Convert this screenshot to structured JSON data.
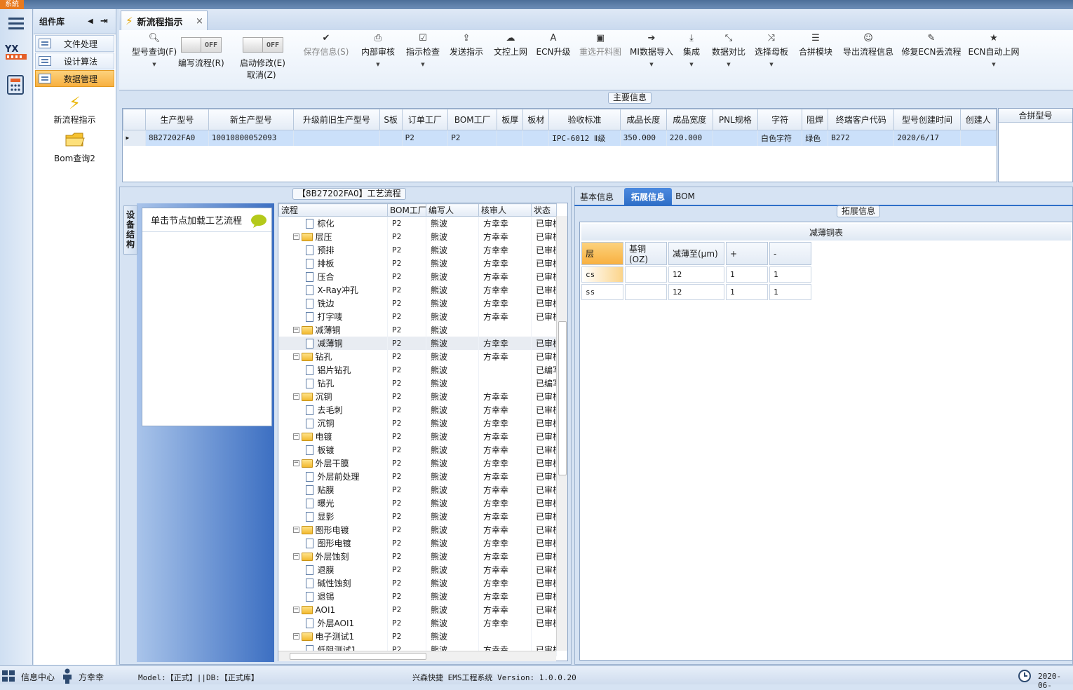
{
  "app": {
    "system_badge": "系統"
  },
  "left_rail": {
    "items": [
      {
        "icon": "menu-icon"
      },
      {
        "icon": "yx-logo-icon"
      },
      {
        "icon": "calculator-icon"
      }
    ]
  },
  "component_library": {
    "title": "组件库",
    "items": [
      {
        "label": "文件处理"
      },
      {
        "label": "设计算法"
      },
      {
        "label": "数据管理",
        "active": true
      }
    ],
    "shortcuts": [
      {
        "label": "新流程指示",
        "icon": "lightning-icon"
      },
      {
        "label": "Bom查询2",
        "icon": "folder-icon"
      }
    ]
  },
  "document_tab": {
    "label": "新流程指示",
    "close": "×"
  },
  "ribbon": {
    "buttons": [
      {
        "label": "型号查询(F)",
        "icon": "search-icon",
        "dropdown": true
      },
      {
        "label": "保存信息(S)",
        "icon": "check-icon",
        "disabled": true
      },
      {
        "label": "内部审核",
        "icon": "print-icon",
        "dropdown": true
      },
      {
        "label": "指示检查",
        "icon": "checkbox-icon",
        "dropdown": true
      },
      {
        "label": "发送指示",
        "icon": "upload-icon"
      },
      {
        "label": "文控上网",
        "icon": "cloud-upload-icon"
      },
      {
        "label": "ECN升级",
        "icon": "font-icon"
      },
      {
        "label": "重选开料图",
        "icon": "image-icon",
        "disabled": true
      },
      {
        "label": "MI数据导入",
        "icon": "sign-in-icon",
        "dropdown": true
      },
      {
        "label": "集成",
        "icon": "download-icon",
        "dropdown": true
      },
      {
        "label": "数据对比",
        "icon": "compress-icon",
        "dropdown": true
      },
      {
        "label": "选择母板",
        "icon": "shuffle-icon",
        "dropdown": true
      },
      {
        "label": "合拼模块",
        "icon": "list-icon"
      },
      {
        "label": "导出流程信息",
        "icon": "smile-icon"
      },
      {
        "label": "修复ECN丢流程",
        "icon": "wrench-icon"
      },
      {
        "label": "ECN自动上网",
        "icon": "star-icon",
        "dropdown": true
      }
    ],
    "toggles": [
      {
        "state": "OFF",
        "label": "编写流程(R)"
      },
      {
        "state": "OFF",
        "label": "启动修改(E)",
        "label2": "取消(Z)"
      }
    ]
  },
  "main_info": {
    "title": "主要信息",
    "columns": [
      "生产型号",
      "新生产型号",
      "升级前旧生产型号",
      "S板",
      "订单工厂",
      "BOM工厂",
      "板厚",
      "板材",
      "验收标准",
      "成品长度",
      "成品宽度",
      "PNL规格",
      "字符",
      "阻焊",
      "终端客户代码",
      "型号创建时间",
      "创建人"
    ],
    "rows": [
      [
        "8B27202FA0",
        "10010800052093",
        "",
        "",
        "P2",
        "P2",
        "",
        "",
        "IPC-6012 Ⅱ级",
        "350.000",
        "220.000",
        "",
        "白色字符",
        "绿色",
        "B272",
        "2020/6/17",
        ""
      ]
    ]
  },
  "merge_panel": {
    "title": "合拼型号"
  },
  "process_panel": {
    "title": "【8B27202FA0】工艺流程",
    "side_tab": "设备结构",
    "node_hint": "单击节点加载工艺流程",
    "columns": [
      "流程",
      "BOM工厂",
      "编写人",
      "核审人",
      "状态"
    ],
    "rows": [
      {
        "level": 1,
        "type": "doc",
        "name": "棕化",
        "bom": "P2",
        "writer": "熊波",
        "reviewer": "方幸幸",
        "status": "已审核"
      },
      {
        "level": 0,
        "type": "folder",
        "name": "层压",
        "bom": "P2",
        "writer": "熊波",
        "reviewer": "方幸幸",
        "status": "已审核"
      },
      {
        "level": 1,
        "type": "doc",
        "name": "预排",
        "bom": "P2",
        "writer": "熊波",
        "reviewer": "方幸幸",
        "status": "已审核"
      },
      {
        "level": 1,
        "type": "doc",
        "name": "排板",
        "bom": "P2",
        "writer": "熊波",
        "reviewer": "方幸幸",
        "status": "已审核"
      },
      {
        "level": 1,
        "type": "doc",
        "name": "压合",
        "bom": "P2",
        "writer": "熊波",
        "reviewer": "方幸幸",
        "status": "已审核"
      },
      {
        "level": 1,
        "type": "doc",
        "name": "X-Ray冲孔",
        "bom": "P2",
        "writer": "熊波",
        "reviewer": "方幸幸",
        "status": "已审核"
      },
      {
        "level": 1,
        "type": "doc",
        "name": "铣边",
        "bom": "P2",
        "writer": "熊波",
        "reviewer": "方幸幸",
        "status": "已审核"
      },
      {
        "level": 1,
        "type": "doc",
        "name": "打字唛",
        "bom": "P2",
        "writer": "熊波",
        "reviewer": "方幸幸",
        "status": "已审核"
      },
      {
        "level": 0,
        "type": "folder",
        "name": "减薄铜",
        "bom": "P2",
        "writer": "熊波",
        "reviewer": "",
        "status": ""
      },
      {
        "level": 1,
        "type": "doc",
        "name": "减薄铜",
        "bom": "P2",
        "writer": "熊波",
        "reviewer": "方幸幸",
        "status": "已审核",
        "selected": true
      },
      {
        "level": 0,
        "type": "folder",
        "name": "钻孔",
        "bom": "P2",
        "writer": "熊波",
        "reviewer": "方幸幸",
        "status": "已审核"
      },
      {
        "level": 1,
        "type": "doc",
        "name": "铝片钻孔",
        "bom": "P2",
        "writer": "熊波",
        "reviewer": "",
        "status": "已编写"
      },
      {
        "level": 1,
        "type": "doc",
        "name": "钻孔",
        "bom": "P2",
        "writer": "熊波",
        "reviewer": "",
        "status": "已编写"
      },
      {
        "level": 0,
        "type": "folder",
        "name": "沉铜",
        "bom": "P2",
        "writer": "熊波",
        "reviewer": "方幸幸",
        "status": "已审核"
      },
      {
        "level": 1,
        "type": "doc",
        "name": "去毛刺",
        "bom": "P2",
        "writer": "熊波",
        "reviewer": "方幸幸",
        "status": "已审核"
      },
      {
        "level": 1,
        "type": "doc",
        "name": "沉铜",
        "bom": "P2",
        "writer": "熊波",
        "reviewer": "方幸幸",
        "status": "已审核"
      },
      {
        "level": 0,
        "type": "folder",
        "name": "电镀",
        "bom": "P2",
        "writer": "熊波",
        "reviewer": "方幸幸",
        "status": "已审核"
      },
      {
        "level": 1,
        "type": "doc",
        "name": "板镀",
        "bom": "P2",
        "writer": "熊波",
        "reviewer": "方幸幸",
        "status": "已审核"
      },
      {
        "level": 0,
        "type": "folder",
        "name": "外层干膜",
        "bom": "P2",
        "writer": "熊波",
        "reviewer": "方幸幸",
        "status": "已审核"
      },
      {
        "level": 1,
        "type": "doc",
        "name": "外层前处理",
        "bom": "P2",
        "writer": "熊波",
        "reviewer": "方幸幸",
        "status": "已审核"
      },
      {
        "level": 1,
        "type": "doc",
        "name": "贴膜",
        "bom": "P2",
        "writer": "熊波",
        "reviewer": "方幸幸",
        "status": "已审核"
      },
      {
        "level": 1,
        "type": "doc",
        "name": "曝光",
        "bom": "P2",
        "writer": "熊波",
        "reviewer": "方幸幸",
        "status": "已审核"
      },
      {
        "level": 1,
        "type": "doc",
        "name": "显影",
        "bom": "P2",
        "writer": "熊波",
        "reviewer": "方幸幸",
        "status": "已审核"
      },
      {
        "level": 0,
        "type": "folder",
        "name": "图形电镀",
        "bom": "P2",
        "writer": "熊波",
        "reviewer": "方幸幸",
        "status": "已审核"
      },
      {
        "level": 1,
        "type": "doc",
        "name": "图形电镀",
        "bom": "P2",
        "writer": "熊波",
        "reviewer": "方幸幸",
        "status": "已审核"
      },
      {
        "level": 0,
        "type": "folder",
        "name": "外层蚀刻",
        "bom": "P2",
        "writer": "熊波",
        "reviewer": "方幸幸",
        "status": "已审核"
      },
      {
        "level": 1,
        "type": "doc",
        "name": "退膜",
        "bom": "P2",
        "writer": "熊波",
        "reviewer": "方幸幸",
        "status": "已审核"
      },
      {
        "level": 1,
        "type": "doc",
        "name": "碱性蚀刻",
        "bom": "P2",
        "writer": "熊波",
        "reviewer": "方幸幸",
        "status": "已审核"
      },
      {
        "level": 1,
        "type": "doc",
        "name": "退锡",
        "bom": "P2",
        "writer": "熊波",
        "reviewer": "方幸幸",
        "status": "已审核"
      },
      {
        "level": 0,
        "type": "folder",
        "name": "AOI1",
        "bom": "P2",
        "writer": "熊波",
        "reviewer": "方幸幸",
        "status": "已审核"
      },
      {
        "level": 1,
        "type": "doc",
        "name": "外层AOI1",
        "bom": "P2",
        "writer": "熊波",
        "reviewer": "方幸幸",
        "status": "已审核"
      },
      {
        "level": 0,
        "type": "folder",
        "name": "电子测试1",
        "bom": "P2",
        "writer": "熊波",
        "reviewer": "",
        "status": ""
      },
      {
        "level": 1,
        "type": "doc",
        "name": "低阻测试1",
        "bom": "P2",
        "writer": "熊波",
        "reviewer": "方幸幸",
        "status": "已审核"
      }
    ]
  },
  "right_tabs": [
    {
      "label": "基本信息"
    },
    {
      "label": "拓展信息",
      "active": true
    },
    {
      "label": "BOM"
    }
  ],
  "extended_info": {
    "title": "拓展信息",
    "table_caption": "减薄铜表",
    "columns": [
      "层",
      "基铜(OZ)",
      "减薄至(μm)",
      "+",
      "-"
    ],
    "rows": [
      [
        "cs",
        "",
        "12",
        "1",
        "1"
      ],
      [
        "ss",
        "",
        "12",
        "1",
        "1"
      ]
    ]
  },
  "status_bar": {
    "info_center": "信息中心",
    "user": "方幸幸",
    "model": "Model:【正式】||DB:【正式库】",
    "version": "兴森快捷 EMS工程系统 Version: 1.0.0.20",
    "date": "2020-06-"
  },
  "colors": {
    "accent_orange": "#f8b040",
    "selection_blue": "#cbe0fa",
    "active_tab": "#2f6fc8"
  }
}
